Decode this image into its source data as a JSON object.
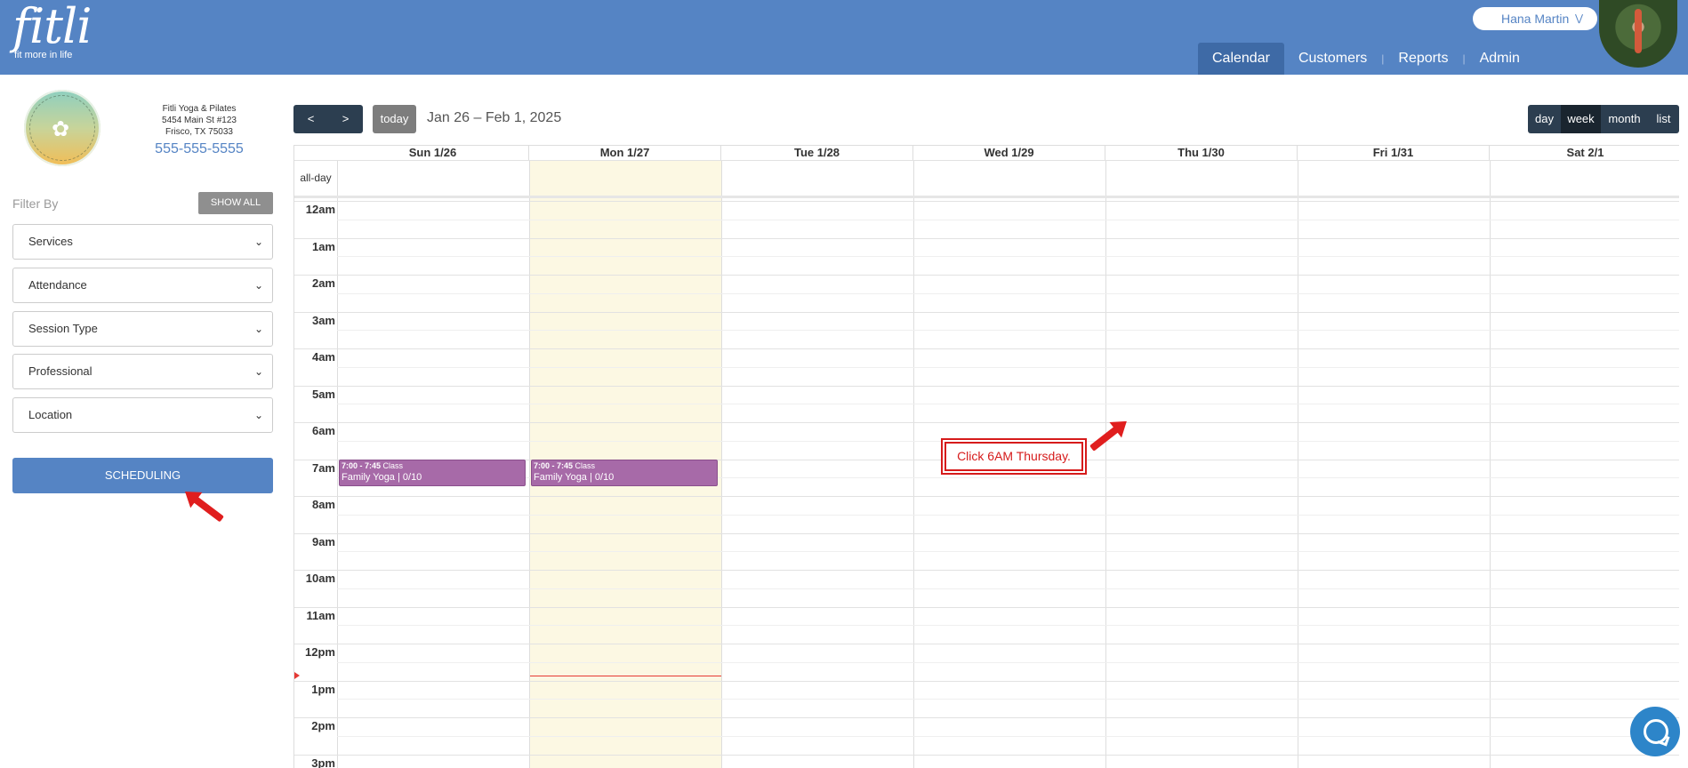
{
  "header": {
    "logo_word": "fitli",
    "logo_tagline": "fit more in life",
    "user_name": "Hana Martin",
    "nav": [
      "Calendar",
      "Customers",
      "Reports",
      "Admin"
    ],
    "nav_active": "Calendar"
  },
  "studio": {
    "name": "Fitli Yoga & Pilates",
    "address1": "5454 Main St #123",
    "address2": "Frisco, TX 75033",
    "phone": "555-555-5555"
  },
  "sidebar": {
    "filter_label": "Filter By",
    "show_all": "SHOW ALL",
    "filters": [
      "Services",
      "Attendance",
      "Session Type",
      "Professional",
      "Location"
    ],
    "scheduling": "SCHEDULING"
  },
  "toolbar": {
    "prev_icon": "chevron-left-icon",
    "next_icon": "chevron-right-icon",
    "prev_glyph": "<",
    "next_glyph": ">",
    "today": "today",
    "range": "Jan 26 – Feb 1, 2025",
    "views": [
      "day",
      "week",
      "month",
      "list"
    ],
    "active_view": "week"
  },
  "calendar": {
    "days": [
      "Sun 1/26",
      "Mon 1/27",
      "Tue 1/28",
      "Wed 1/29",
      "Thu 1/30",
      "Fri 1/31",
      "Sat 2/1"
    ],
    "today_index": 1,
    "allday_label": "all-day",
    "hours": [
      "12am",
      "1am",
      "2am",
      "3am",
      "4am",
      "5am",
      "6am",
      "7am",
      "8am",
      "9am",
      "10am",
      "11am",
      "12pm",
      "1pm",
      "2pm",
      "3pm"
    ],
    "events": [
      {
        "day_index": 0,
        "time": "7:00 - 7:45",
        "type": "Class",
        "title": "Family Yoga | 0/10",
        "color": "#a76aa8"
      },
      {
        "day_index": 1,
        "time": "7:00 - 7:45",
        "type": "Class",
        "title": "Family Yoga | 0/10",
        "color": "#a76aa8"
      }
    ]
  },
  "annotation": {
    "callout": "Click 6AM Thursday."
  },
  "colors": {
    "brand": "#5584c4",
    "toolbar": "#2c3e50",
    "event": "#a76aa8",
    "today_bg": "#fcf8e3",
    "annotation": "#d61b1b"
  },
  "chat_icon": "chat-bubble-icon"
}
